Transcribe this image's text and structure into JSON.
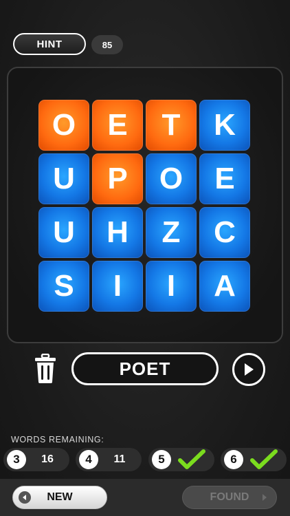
{
  "header": {
    "hint_label": "HINT",
    "hint_count": "85"
  },
  "board": {
    "rows": [
      [
        {
          "letter": "O",
          "color": "orange"
        },
        {
          "letter": "E",
          "color": "orange"
        },
        {
          "letter": "T",
          "color": "orange"
        },
        {
          "letter": "K",
          "color": "blue"
        }
      ],
      [
        {
          "letter": "U",
          "color": "blue"
        },
        {
          "letter": "P",
          "color": "orange"
        },
        {
          "letter": "O",
          "color": "blue"
        },
        {
          "letter": "E",
          "color": "blue"
        }
      ],
      [
        {
          "letter": "U",
          "color": "blue"
        },
        {
          "letter": "H",
          "color": "blue"
        },
        {
          "letter": "Z",
          "color": "blue"
        },
        {
          "letter": "C",
          "color": "blue"
        }
      ],
      [
        {
          "letter": "S",
          "color": "blue"
        },
        {
          "letter": "I",
          "color": "blue"
        },
        {
          "letter": "I",
          "color": "blue"
        },
        {
          "letter": "A",
          "color": "blue"
        }
      ]
    ],
    "colors": {
      "orange": "#ff6a10",
      "blue": "#1478e6"
    }
  },
  "word_row": {
    "current_word": "POET",
    "trash_icon": "trash-icon",
    "submit_icon": "play-icon"
  },
  "remaining": {
    "label": "WORDS REMAINING:",
    "groups": [
      {
        "length": "3",
        "count": "16",
        "done": false
      },
      {
        "length": "4",
        "count": "11",
        "done": false
      },
      {
        "length": "5",
        "count": "",
        "done": true
      },
      {
        "length": "6",
        "count": "",
        "done": true
      }
    ],
    "check_color": "#7bdc1e"
  },
  "footer": {
    "new_label": "NEW",
    "found_label": "FOUND"
  }
}
